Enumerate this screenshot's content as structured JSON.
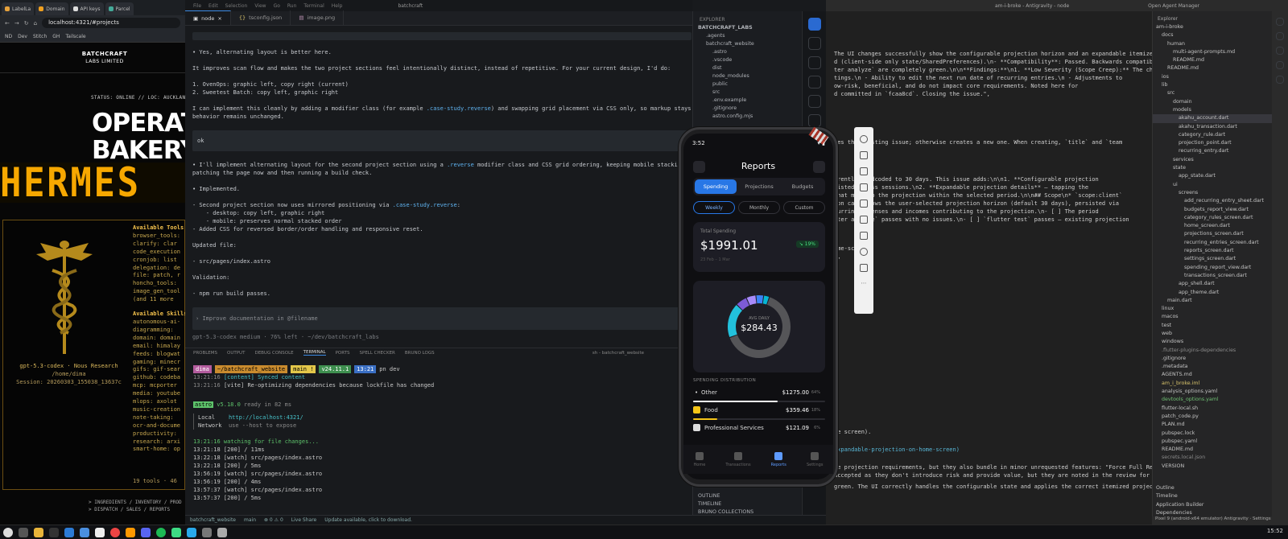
{
  "browser": {
    "tabs": [
      "LabelLa",
      "Domain",
      "API keys",
      "Parcel"
    ],
    "url": "localhost:4321/#projects",
    "bookmarks": [
      "ND",
      "Dev",
      "Stitch",
      "GH",
      "Tailscale"
    ],
    "site_logo": "BATCHCRAFT",
    "site_logo_sub": "LABS LIMITED",
    "status": "STATUS: ONLINE // LOC: AUCKLAND, NZ",
    "hero_line1": "OPERAT",
    "hero_line2": "BAKERY",
    "footer_line1": "> INGREDIENTS / INVENTORY / PROD",
    "footer_line2": "> DISPATCH / SALES / REPORTS"
  },
  "hermes": {
    "banner": "HERMES",
    "model": "gpt-5.3-codex · Nous Research",
    "home": "/home/dima",
    "session": "Session: 20260303_155038_13637c",
    "tools_title": "Available Tools",
    "tools": [
      "browser_tools:",
      "clarify: clar",
      "code_execution",
      "cronjob: list",
      "delegation: de",
      "file: patch, r",
      "honcho_tools:",
      "image_gen_tool",
      "(and 11 more"
    ],
    "skills_title": "Available Skills",
    "skills": [
      "autonomous-ai-",
      "diagramming:",
      "domain: domain",
      "email: himalay",
      "feeds: blogwat",
      "gaming: minecr",
      "gifs: gif-sear",
      "github: codeba",
      "mcp: mcporter",
      "media: youtube",
      "mlops: axolot",
      "music-creation",
      "note-taking: ",
      "ocr-and-docume",
      "productivity:",
      "research: arxi",
      "smart-home: op"
    ],
    "count": "19 tools · 46"
  },
  "vscode": {
    "menu": [
      "File",
      "Edit",
      "Selection",
      "View",
      "Go",
      "Run",
      "Terminal",
      "Help"
    ],
    "window_title": "batchcraft",
    "tabs": [
      "node",
      "tsconfig.json",
      "image.png"
    ],
    "chat": {
      "l1": "• Yes, alternating layout is better here.",
      "l2": "It improves scan flow and makes the two project sections feel intentionally distinct, instead of repetitive. For your current design, I'd do:",
      "l3": "1. OvenOps: graphic left, copy right (current)",
      "l4": "2. Sweetest Batch: copy left, graphic right",
      "l5a": "I can implement this cleanly by adding a modifier class (for example ",
      "l5code": ".case-study.reverse",
      "l5b": ") and swapping grid placement via CSS only, so markup stays simple and mobile",
      "l6": "behavior remains unchanged.",
      "user": "ok",
      "l7a": "• I'll implement alternating layout for the second project section using a ",
      "l7code": ".reverse",
      "l7b": " modifier class and CSS grid ordering, keeping mobile stacking unchanged. I'm",
      "l8": "patching the page now and then running a build check.",
      "l9": "• Implemented.",
      "l10a": "- Second project section now uses mirrored positioning via ",
      "l10code": ".case-study.reverse",
      "l10b": ":",
      "l11": "    - desktop: copy left, graphic right",
      "l12": "    - mobile: preserves normal stacked order",
      "l13": "- Added CSS for reversed border/order handling and responsive reset.",
      "l14": "Updated file:",
      "l15": "- src/pages/index.astro",
      "l16": "Validation:",
      "l17": "- npm run build passes.",
      "prompt": "Improve documentation in @filename",
      "footer": "gpt-5.3-codex medium · 76% left · ~/dev/batchcraft_labs"
    },
    "panel_tabs": [
      "PROBLEMS",
      "OUTPUT",
      "DEBUG CONSOLE",
      "TERMINAL",
      "PORTS",
      "SPELL CHECKER",
      "BRUNO LOGS"
    ],
    "terminal_name": "sh - batchcraft_website",
    "terminal": {
      "prompt_user": "dima",
      "prompt_dir": "~/batchcraft_website",
      "prompt_branch": "main !",
      "prompt_node": "v24.11.1",
      "prompt_time": "13:21",
      "prompt_cmd": "pn dev",
      "lines": [
        {
          "t": "13:21:16",
          "x": "[content] Synced content"
        },
        {
          "t": "13:21:16",
          "x": "[vite] Re-optimizing dependencies because lockfile has changed"
        }
      ],
      "astro_badge": "astro",
      "astro_ver": "v5.18.0",
      "astro_ready": "ready in 82 ms",
      "local_label": "Local",
      "local_url": "http://localhost:4321/",
      "network_label": "Network",
      "network_val": "use --host to expose",
      "watch": "13:21:16 watching for file changes...",
      "log": [
        "13:21:18 [200] / 11ms",
        "13:22:18 [watch] src/pages/index.astro",
        "13:22:18 [200] / 5ms",
        "13:56:19 [watch] src/pages/index.astro",
        "13:56:19 [200] / 4ms",
        "13:57:37 [watch] src/pages/index.astro",
        "13:57:37 [200] / 5ms"
      ]
    },
    "statusbar": [
      "batchcraft_website",
      "main",
      "⊗ 0 ⚠ 0",
      "Live Share",
      "Update available, click to download."
    ],
    "explorer_title": "EXPLORER",
    "explorer_root": "BATCHCRAFT_LABS",
    "explorer_items": [
      ".agents",
      "batchcraft_website",
      ".astro",
      ".vscode",
      "dist",
      "node_modules",
      "public",
      "src",
      ".env.example",
      ".gitignore",
      "astro.config.mjs"
    ],
    "explorer_bottom": [
      "OUTLINE",
      "TIMELINE",
      "BRUNO COLLECTIONS"
    ]
  },
  "phone": {
    "time": "3:52",
    "title": "Reports",
    "segments": [
      "Spending",
      "Projections",
      "Budgets"
    ],
    "periods": [
      "Weekly",
      "Monthly",
      "Custom"
    ],
    "total_label": "Total Spending",
    "total_value": "$1991.01",
    "total_change": "↘ 19%",
    "total_range": "23 Feb – 1 Mar",
    "donut_label": "AVG DAILY",
    "donut_value": "$284.43",
    "dist_title": "SPENDING DISTRIBUTION",
    "distribution": [
      {
        "name": "Other",
        "amount": "$1275.00",
        "pct": "64%",
        "share": 0.64,
        "color": "#ffffff"
      },
      {
        "name": "Food",
        "amount": "$359.46",
        "pct": "18%",
        "share": 0.18,
        "color": "#f5c518"
      },
      {
        "name": "Professional Services",
        "amount": "$121.09",
        "pct": "6%",
        "share": 0.06,
        "color": "#ffffff"
      }
    ],
    "nav": [
      "Home",
      "Transactions",
      "Reports",
      "Settings"
    ],
    "donut_segments": [
      {
        "share": 0.64,
        "color": "#555558"
      },
      {
        "share": 0.18,
        "color": "#22c1dc"
      },
      {
        "share": 0.06,
        "color": "#7d5bd6"
      },
      {
        "share": 0.05,
        "color": "#a78bfa"
      },
      {
        "share": 0.04,
        "color": "#3b82f6"
      },
      {
        "share": 0.03,
        "color": "#06b6d4"
      }
    ]
  },
  "antigravity": {
    "title": "am-i-broke - Antigravity - node",
    "manager": "Open Agent Manager",
    "lines": {
      "a1": "The UI changes successfully show the configurable projection horizon and an expandable itemized list",
      "a2": "d (client-side only state/SharedPreferences).\\n- **Compatibility**: Passed. Backwards compatible,",
      "a3": "ter analyze` are completely green.\\n\\n**Findings:**\\n1. **Low Severity (Scope Creep):** The changes",
      "a4": "tings.\\n    - Ability to edit the next run date of recurring entries.\\n    - Adjustments to",
      "a5": "ow-risk, beneficial, and do not impact core requirements. Noted here for",
      "a6": "d committed in `fcaa8cd`. Closing the issue.\",",
      "b1": "tes the existing issue; otherwise creates a new one. When creating, `title` and `team",
      "c1": "rrently hardcoded to 30 days. This issue adds:\\n\\n1. **Configurable projection",
      "c2": "sisted across sessions.\\n2. **Expandable projection details** — tapping the",
      "c3": "that make up the projection within the selected period.\\n\\n## Scope\\n* `scope:client`",
      "c4": "ion card shows the user-selected projection horizon (default 30 days), persisted via",
      "c5": "curring expenses and incomes contributing to the projection.\\n- [ ] The period",
      "c6": "tter analyze` passes with no issues.\\n- [ ] `flutter test` passes — existing projection",
      "d1": "ome-screen\",",
      "d2": "\",",
      "e1": "me screen).",
      "e2": "expandable-projection-on-home-screen)",
      "e3": "le projection requirements, but they also bundle in minor unrequested features: \"Force Full Resync\"",
      "e4": "accepted as they don't introduce risk and provide value, but they are noted in the review for",
      "e5": "green. The UI correctly handles the configurable state and applies the correct itemized projection"
    },
    "explorer_title": "Explorer",
    "tree": [
      {
        "n": "am-i-broke",
        "d": 0,
        "k": ""
      },
      {
        "n": "docs",
        "d": 1,
        "k": ""
      },
      {
        "n": "human",
        "d": 2,
        "k": ""
      },
      {
        "n": "multi-agent-prompts.md",
        "d": 3,
        "k": ""
      },
      {
        "n": "README.md",
        "d": 3,
        "k": ""
      },
      {
        "n": "README.md",
        "d": 2,
        "k": ""
      },
      {
        "n": "ios",
        "d": 1,
        "k": ""
      },
      {
        "n": "lib",
        "d": 1,
        "k": ""
      },
      {
        "n": "src",
        "d": 2,
        "k": ""
      },
      {
        "n": "domain",
        "d": 3,
        "k": ""
      },
      {
        "n": "models",
        "d": 3,
        "k": ""
      },
      {
        "n": "akahu_account.dart",
        "d": 4,
        "k": "sel"
      },
      {
        "n": "akahu_transaction.dart",
        "d": 4,
        "k": ""
      },
      {
        "n": "category_rule.dart",
        "d": 4,
        "k": ""
      },
      {
        "n": "projection_point.dart",
        "d": 4,
        "k": ""
      },
      {
        "n": "recurring_entry.dart",
        "d": 4,
        "k": ""
      },
      {
        "n": "services",
        "d": 3,
        "k": ""
      },
      {
        "n": "state",
        "d": 3,
        "k": ""
      },
      {
        "n": "app_state.dart",
        "d": 4,
        "k": ""
      },
      {
        "n": "ui",
        "d": 3,
        "k": ""
      },
      {
        "n": "screens",
        "d": 4,
        "k": ""
      },
      {
        "n": "add_recurring_entry_sheet.dart",
        "d": 5,
        "k": ""
      },
      {
        "n": "budgets_report_view.dart",
        "d": 5,
        "k": ""
      },
      {
        "n": "category_rules_screen.dart",
        "d": 5,
        "k": ""
      },
      {
        "n": "home_screen.dart",
        "d": 5,
        "k": ""
      },
      {
        "n": "projections_screen.dart",
        "d": 5,
        "k": ""
      },
      {
        "n": "recurring_entries_screen.dart",
        "d": 5,
        "k": ""
      },
      {
        "n": "reports_screen.dart",
        "d": 5,
        "k": ""
      },
      {
        "n": "settings_screen.dart",
        "d": 5,
        "k": ""
      },
      {
        "n": "spending_report_view.dart",
        "d": 5,
        "k": ""
      },
      {
        "n": "transactions_screen.dart",
        "d": 5,
        "k": ""
      },
      {
        "n": "app_shell.dart",
        "d": 4,
        "k": ""
      },
      {
        "n": "app_theme.dart",
        "d": 4,
        "k": ""
      },
      {
        "n": "main.dart",
        "d": 2,
        "k": ""
      },
      {
        "n": "linux",
        "d": 1,
        "k": ""
      },
      {
        "n": "macos",
        "d": 1,
        "k": ""
      },
      {
        "n": "test",
        "d": 1,
        "k": ""
      },
      {
        "n": "web",
        "d": 1,
        "k": ""
      },
      {
        "n": "windows",
        "d": 1,
        "k": ""
      },
      {
        "n": ".flutter-plugins-dependencies",
        "d": 1,
        "k": "dim"
      },
      {
        "n": ".gitignore",
        "d": 1,
        "k": ""
      },
      {
        "n": ".metadata",
        "d": 1,
        "k": ""
      },
      {
        "n": "AGENTS.md",
        "d": 1,
        "k": ""
      },
      {
        "n": "am_i_broke.iml",
        "d": 1,
        "k": "mod"
      },
      {
        "n": "analysis_options.yaml",
        "d": 1,
        "k": ""
      },
      {
        "n": "devtools_options.yaml",
        "d": 1,
        "k": "unt"
      },
      {
        "n": "flutter-local.sh",
        "d": 1,
        "k": ""
      },
      {
        "n": "patch_code.py",
        "d": 1,
        "k": ""
      },
      {
        "n": "PLAN.md",
        "d": 1,
        "k": ""
      },
      {
        "n": "pubspec.lock",
        "d": 1,
        "k": ""
      },
      {
        "n": "pubspec.yaml",
        "d": 1,
        "k": ""
      },
      {
        "n": "README.md",
        "d": 1,
        "k": ""
      },
      {
        "n": "secrets.local.json",
        "d": 1,
        "k": "dim"
      },
      {
        "n": "VERSION",
        "d": 1,
        "k": ""
      }
    ],
    "bottom": [
      "Outline",
      "Timeline",
      "Application Builder",
      "Dependencies"
    ],
    "status": "Pixel 9 (android-x64 emulator)   Antigravity · Settings"
  },
  "taskbar": {
    "clock": "15:52"
  }
}
